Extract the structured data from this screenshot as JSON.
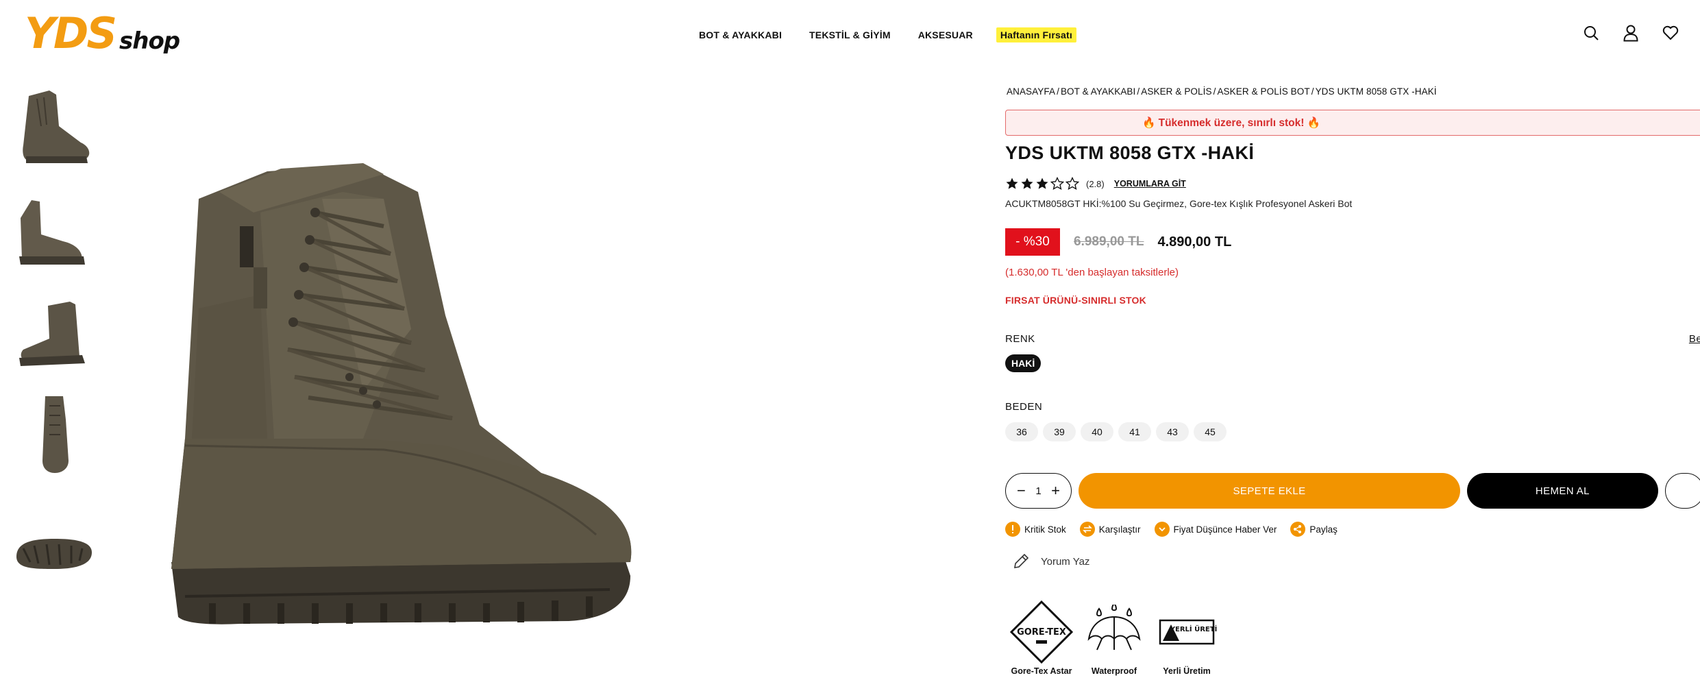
{
  "header": {
    "logo": "YDS shop",
    "nav": [
      {
        "label": "BOT & AYAKKABI"
      },
      {
        "label": "TEKSTİL & GİYİM"
      },
      {
        "label": "AKSESUAR"
      },
      {
        "label": "Haftanın Fırsatı"
      }
    ],
    "icons": [
      "search-icon",
      "user-icon",
      "heart-icon",
      "cart-icon"
    ]
  },
  "breadcrumb": [
    "ANASAYFA",
    "BOT & AYAKKABI",
    "ASKER & POLİS",
    "ASKER & POLİS BOT",
    "YDS UKTM 8058 GTX -HAKİ"
  ],
  "stock_banner": "🔥 Tükenmek üzere, sınırlı stok! 🔥",
  "product": {
    "title": "YDS UKTM 8058 GTX -HAKİ",
    "rating": 2.8,
    "rating_text": "(2.8)",
    "reviews_link": "YORUMLARA GİT",
    "description": "ACUKTM8058GT HKİ:%100 Su Geçirmez, Gore-tex Kışlık Profesyonel Askeri Bot",
    "discount": "- %30",
    "old_price": "6.989,00 TL",
    "new_price": "4.890,00 TL",
    "installment": "(1.630,00 TL 'den başlayan taksitlerle)",
    "firsat": "FIRSAT ÜRÜNÜ-SINIRLI STOK",
    "color_label": "RENK",
    "size_guide": "Beden Ta",
    "color_value": "HAKİ",
    "size_label": "BEDEN",
    "sizes": [
      "36",
      "39",
      "40",
      "41",
      "43",
      "45"
    ],
    "quantity": "1",
    "add_to_cart": "SEPETE EKLE",
    "buy_now": "HEMEN AL"
  },
  "actions": [
    {
      "label": "Kritik Stok",
      "icon": "exclamation-icon"
    },
    {
      "label": "Karşılaştır",
      "icon": "compare-icon"
    },
    {
      "label": "Fiyat Düşünce Haber Ver",
      "icon": "chevron-down-icon"
    },
    {
      "label": "Paylaş",
      "icon": "share-icon"
    }
  ],
  "write_review": "Yorum Yaz",
  "features": [
    {
      "label": "Gore-Tex Astar",
      "badge_text": "GORE-TEX"
    },
    {
      "label": "Waterproof"
    },
    {
      "label": "Yerli Üretim",
      "badge_text": "YERLİ ÜRETİM"
    }
  ],
  "colors": {
    "accent": "#f29400",
    "logo": "#f39c12",
    "danger": "#d62d2d",
    "discount": "#e1111c",
    "deal_highlight": "#fff03b"
  }
}
